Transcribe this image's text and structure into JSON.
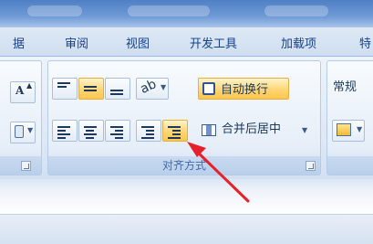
{
  "tabs": [
    "据",
    "审阅",
    "视图",
    "开发工具",
    "加载项",
    "特"
  ],
  "font_group": {
    "font_size_up_label": "A"
  },
  "alignment_group": {
    "label": "对齐方式",
    "wrap_text_label": "自动换行",
    "merge_center_label": "合并后居中"
  },
  "number_group": {
    "format_value": "常规"
  },
  "colors": {
    "highlight": "#ffd675",
    "annotation_arrow": "#e8202a",
    "tab_text": "#15428b"
  }
}
